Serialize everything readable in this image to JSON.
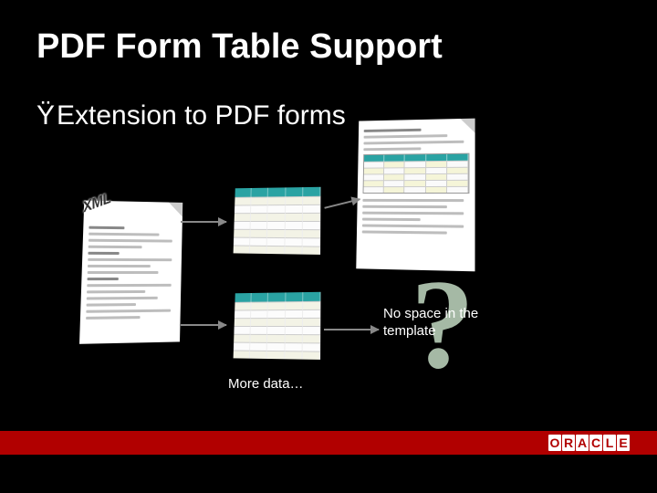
{
  "title": "PDF Form Table Support",
  "bullet": {
    "mark": "Ÿ",
    "text": "Extension to PDF forms"
  },
  "labels": {
    "xml": "XML",
    "more_data": "More data…",
    "no_space": "No space in the template"
  },
  "qmark": "?",
  "logo_letters": [
    "O",
    "R",
    "A",
    "C",
    "L",
    "E"
  ],
  "colors": {
    "brand_red": "#b10000",
    "table_header": "#2aa3a3"
  }
}
